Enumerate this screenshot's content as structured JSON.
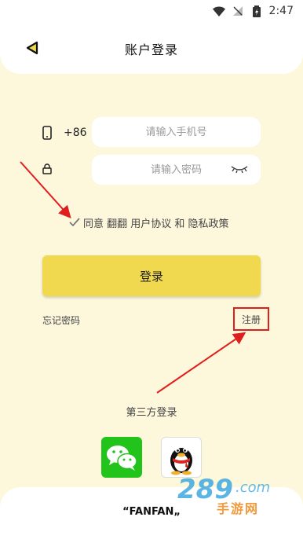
{
  "status_bar": {
    "time": "2:47"
  },
  "header": {
    "title": "账户登录"
  },
  "phone": {
    "prefix": "+86",
    "placeholder": "请输入手机号",
    "value": ""
  },
  "password": {
    "placeholder": "请输入密码",
    "value": ""
  },
  "agreement": {
    "checked": true,
    "text": "同意 翻翻 用户协议 和 隐私政策"
  },
  "login_button": "登录",
  "forgot_password": "忘记密码",
  "register": "注册",
  "third_party": {
    "title": "第三方登录",
    "options": [
      "wechat-icon",
      "qq-icon"
    ]
  },
  "footer": {
    "brand": "“FANFAN„"
  },
  "watermark": {
    "logo": "289.com",
    "subtitle": "手游网"
  },
  "colors": {
    "primary": "#f0d94e",
    "background": "#fdf7dc",
    "annotation": "#e11e1e",
    "wechat": "#22c41b"
  }
}
